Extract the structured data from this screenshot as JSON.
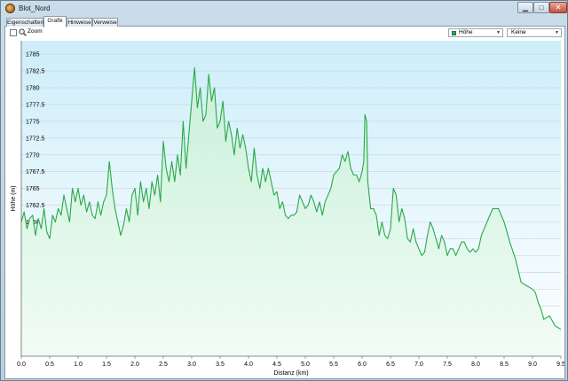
{
  "window": {
    "title": "Blot_Nord",
    "minimize_glyph": "▁",
    "maximize_glyph": "□",
    "close_glyph": "✕"
  },
  "tabs": [
    {
      "label": "Eigenschaften"
    },
    {
      "label": "Grafik",
      "active": true
    },
    {
      "label": "Hinweise"
    },
    {
      "label": "Verweise"
    }
  ],
  "toolbar": {
    "zoom_label": "Zoom",
    "zoom_checked": false,
    "series_select": {
      "value": "Höhe",
      "color": "#2aa84a"
    },
    "compare_select": {
      "value": "Keine"
    }
  },
  "colors": {
    "line": "#2aa84a",
    "plot_bg_top": "#cdeefa",
    "plot_bg_bottom": "#ffffff",
    "fill_top": "#c8f0d8",
    "fill_bottom": "#f2fcf6",
    "grid": "#c8d0d8"
  },
  "chart_data": {
    "type": "area",
    "xlabel": "Distanz  (km)",
    "ylabel": "Höhe (m)",
    "xlim": [
      0.0,
      9.5
    ],
    "ylim": [
      1740,
      1787
    ],
    "grid": true,
    "legend": "none",
    "x_ticks": [
      "0.0",
      "0.5",
      "1.0",
      "1.5",
      "2.0",
      "2.5",
      "3.0",
      "3.5",
      "4.0",
      "4.5",
      "5.0",
      "5.5",
      "6.0",
      "6.5",
      "7.0",
      "7.5",
      "8.0",
      "8.5",
      "9.0",
      "9.5"
    ],
    "y_ticks": [
      "1785",
      "1782.5",
      "1780",
      "1777.5",
      "1775",
      "1772.5",
      "1770",
      "1767.5",
      "1765",
      "1762.5",
      "1760",
      "1757.5",
      "1755",
      "1752.5",
      "1750",
      "1747.5",
      "1745",
      "1742.5"
    ],
    "series": [
      {
        "x": [
          0.0,
          0.05,
          0.1,
          0.15,
          0.2,
          0.25,
          0.3,
          0.35,
          0.4,
          0.45,
          0.5,
          0.55,
          0.6,
          0.65,
          0.7,
          0.75,
          0.8,
          0.85,
          0.9,
          0.95,
          1.0,
          1.05,
          1.1,
          1.15,
          1.2,
          1.25,
          1.3,
          1.35,
          1.4,
          1.45,
          1.5,
          1.55,
          1.6,
          1.65,
          1.7,
          1.75,
          1.8,
          1.85,
          1.9,
          1.95,
          2.0,
          2.05,
          2.1,
          2.15,
          2.2,
          2.25,
          2.3,
          2.35,
          2.4,
          2.45,
          2.5,
          2.55,
          2.6,
          2.65,
          2.7,
          2.75,
          2.8,
          2.85,
          2.9,
          2.95,
          3.0,
          3.05,
          3.1,
          3.15,
          3.2,
          3.25,
          3.3,
          3.35,
          3.4,
          3.45,
          3.5,
          3.55,
          3.6,
          3.65,
          3.7,
          3.75,
          3.8,
          3.85,
          3.9,
          3.95,
          4.0,
          4.05,
          4.1,
          4.15,
          4.2,
          4.25,
          4.3,
          4.35,
          4.4,
          4.45,
          4.5,
          4.55,
          4.6,
          4.65,
          4.7,
          4.75,
          4.8,
          4.85,
          4.9,
          4.95,
          5.0,
          5.05,
          5.1,
          5.15,
          5.2,
          5.25,
          5.3,
          5.35,
          5.4,
          5.45,
          5.5,
          5.55,
          5.6,
          5.65,
          5.7,
          5.75,
          5.8,
          5.85,
          5.9,
          5.95,
          6.0,
          6.03,
          6.05,
          6.08,
          6.1,
          6.15,
          6.2,
          6.25,
          6.3,
          6.35,
          6.4,
          6.45,
          6.5,
          6.55,
          6.6,
          6.65,
          6.7,
          6.75,
          6.8,
          6.85,
          6.9,
          6.95,
          7.0,
          7.05,
          7.1,
          7.15,
          7.2,
          7.25,
          7.3,
          7.35,
          7.4,
          7.45,
          7.5,
          7.55,
          7.6,
          7.65,
          7.7,
          7.75,
          7.8,
          7.85,
          7.9,
          7.95,
          8.0,
          8.05,
          8.1,
          8.2,
          8.3,
          8.4,
          8.5,
          8.6,
          8.7,
          8.8,
          8.9,
          9.0,
          9.05,
          9.1,
          9.15,
          9.2,
          9.3,
          9.4,
          9.5
        ],
        "y": [
          1760,
          1761.5,
          1759,
          1760.5,
          1761,
          1758,
          1760.5,
          1759,
          1762,
          1758.5,
          1757.5,
          1761,
          1760,
          1762,
          1761,
          1764,
          1762,
          1760,
          1765,
          1763,
          1765,
          1762.5,
          1764,
          1761.5,
          1763,
          1761,
          1760.5,
          1763,
          1761,
          1763,
          1764,
          1769,
          1765,
          1762,
          1760,
          1758,
          1759.5,
          1762,
          1760,
          1764,
          1765,
          1761,
          1766,
          1763,
          1765,
          1762,
          1766,
          1764,
          1767,
          1763,
          1772,
          1768,
          1766,
          1769,
          1766,
          1770,
          1767,
          1775,
          1768,
          1773,
          1778,
          1783,
          1777,
          1780,
          1775,
          1776,
          1782,
          1778,
          1780,
          1774,
          1775,
          1778,
          1772,
          1775,
          1773,
          1770,
          1774,
          1771,
          1773,
          1771,
          1768,
          1766,
          1771,
          1767,
          1765,
          1768,
          1766,
          1768,
          1766,
          1764,
          1764.5,
          1762,
          1763,
          1761,
          1760.5,
          1761,
          1761,
          1761.5,
          1764,
          1763,
          1762,
          1762.5,
          1764,
          1763,
          1761.5,
          1763,
          1761,
          1763,
          1764,
          1765,
          1767,
          1767.5,
          1768,
          1770,
          1769,
          1770.5,
          1768,
          1767,
          1767,
          1766,
          1767.5,
          1769,
          1776,
          1775,
          1766,
          1762,
          1762,
          1761,
          1758,
          1760,
          1758,
          1757.5,
          1759,
          1765,
          1764,
          1760,
          1762,
          1760.5,
          1757.5,
          1757,
          1759,
          1757,
          1756,
          1755,
          1755.5,
          1758,
          1760,
          1759,
          1757.5,
          1756,
          1758,
          1757,
          1755,
          1756,
          1756,
          1755,
          1756,
          1757,
          1757,
          1756,
          1755.5,
          1756,
          1755.5,
          1756,
          1758,
          1760,
          1762,
          1762,
          1760,
          1757,
          1754.5,
          1751,
          1750.5,
          1750,
          1749.5,
          1748,
          1747,
          1745.5,
          1746,
          1744.5,
          1744
        ]
      }
    ]
  }
}
